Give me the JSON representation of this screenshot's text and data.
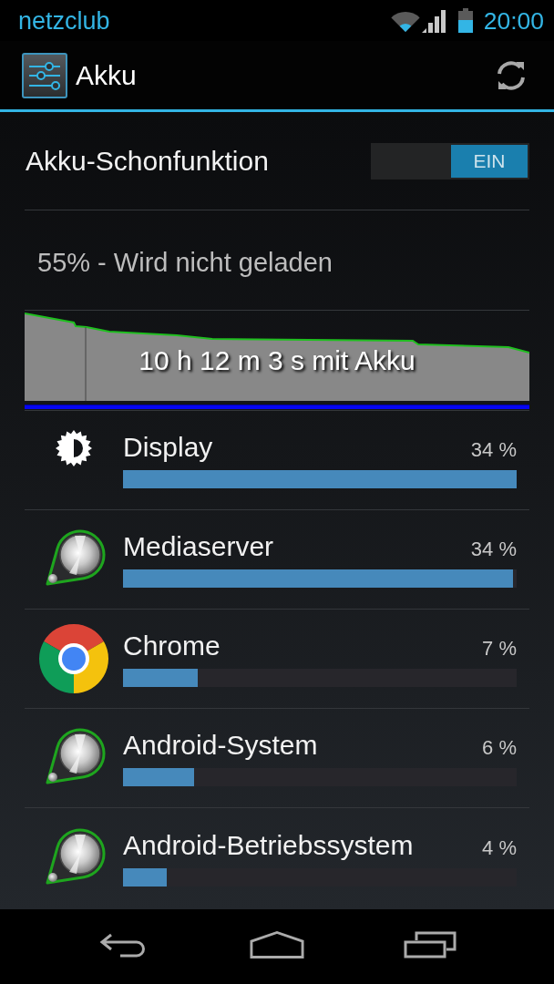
{
  "status_bar": {
    "carrier": "netzclub",
    "time": "20:00"
  },
  "action_bar": {
    "title": "Akku"
  },
  "battery_saver": {
    "label": "Akku-Schonfunktion",
    "toggle_label": "EIN",
    "on": true
  },
  "battery_status": {
    "text": "55% - Wird nicht geladen"
  },
  "history": {
    "label": "10 h 12 m 3 s mit Akku"
  },
  "usage": [
    {
      "kind": "display",
      "name": "Display",
      "percent": "34 %",
      "level": 1.0
    },
    {
      "kind": "service",
      "name": "Mediaserver",
      "percent": "34 %",
      "level": 0.99
    },
    {
      "kind": "browser",
      "name": "Chrome",
      "percent": "7 %",
      "level": 0.19
    },
    {
      "kind": "service",
      "name": "Android-System",
      "percent": "6 %",
      "level": 0.18
    },
    {
      "kind": "service",
      "name": "Android-Betriebssystem",
      "percent": "4 %",
      "level": 0.11
    }
  ]
}
